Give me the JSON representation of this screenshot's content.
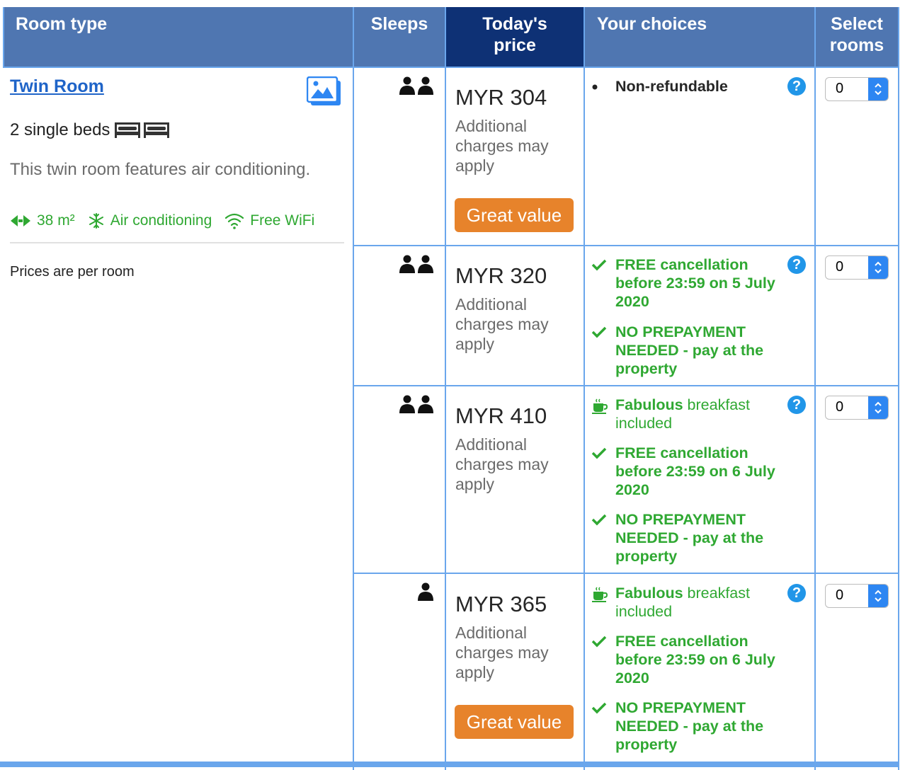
{
  "header": {
    "room_type": "Room type",
    "sleeps": "Sleeps",
    "price_line1": "Today's",
    "price_line2": "price",
    "choices": "Your choices",
    "select_line1": "Select",
    "select_line2": "rooms"
  },
  "room": {
    "title": "Twin Room",
    "beds": "2 single beds",
    "description": "This twin room features air conditioning.",
    "facilities": [
      "38 m²",
      "Air conditioning",
      "Free WiFi"
    ],
    "prices_note": "Prices are per room"
  },
  "options": [
    {
      "sleeps": 2,
      "price": "MYR 304",
      "additional": "Additional charges may apply",
      "badge": "Great value",
      "choices": [
        "Non-refundable"
      ],
      "select_value": "0"
    },
    {
      "sleeps": 2,
      "price": "MYR 320",
      "additional": "Additional charges may apply",
      "choices": [
        "FREE cancellation before 23:59 on 5 July 2020",
        "NO PREPAYMENT NEEDED - pay at the property"
      ],
      "select_value": "0"
    },
    {
      "sleeps": 2,
      "price": "MYR 410",
      "additional": "Additional charges may apply",
      "breakfast_strong": "Fabulous",
      "breakfast_rest": " breakfast included",
      "choices": [
        "FREE cancellation before 23:59 on 6 July 2020",
        "NO PREPAYMENT NEEDED - pay at the property"
      ],
      "select_value": "0"
    },
    {
      "sleeps": 1,
      "price": "MYR 365",
      "additional": "Additional charges may apply",
      "badge": "Great value",
      "breakfast_strong": "Fabulous",
      "breakfast_rest": " breakfast included",
      "choices": [
        "FREE cancellation before 23:59 on 6 July 2020",
        "NO PREPAYMENT NEEDED - pay at the property"
      ],
      "select_value": "0"
    }
  ],
  "help_glyph": "?",
  "colors": {
    "header": "#4f76b1",
    "header_active": "#0e3175",
    "accent_green": "#2fa832",
    "badge_orange": "#e7832b",
    "link_blue": "#1f64c8",
    "grid_blue": "#6aa6ec"
  }
}
